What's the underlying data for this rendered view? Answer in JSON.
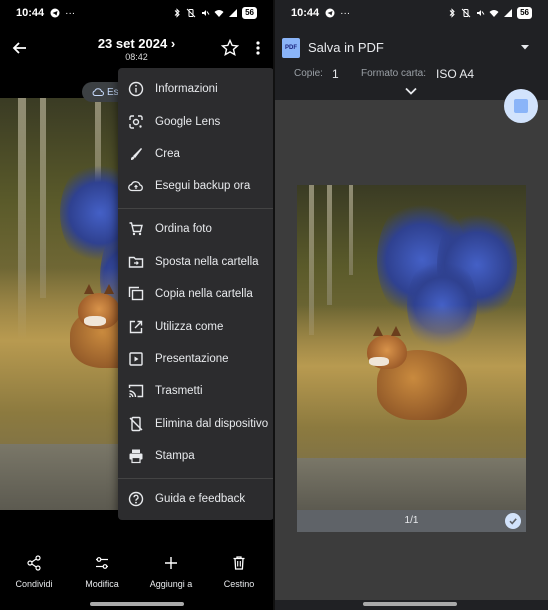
{
  "status": {
    "time": "10:44",
    "dots": "···",
    "battery": "56"
  },
  "left": {
    "header": {
      "date": "23 set 2024 ›",
      "time": "08:42"
    },
    "backup_chip": "Es",
    "menu": {
      "items": [
        {
          "label": "Informazioni",
          "icon": "info-icon"
        },
        {
          "label": "Google Lens",
          "icon": "google-lens-icon"
        },
        {
          "label": "Crea",
          "icon": "brush-icon"
        },
        {
          "label": "Esegui backup ora",
          "icon": "cloud-upload-icon"
        },
        {
          "label": "Ordina foto",
          "icon": "cart-icon"
        },
        {
          "label": "Sposta nella cartella",
          "icon": "folder-move-icon"
        },
        {
          "label": "Copia nella cartella",
          "icon": "copy-icon"
        },
        {
          "label": "Utilizza come",
          "icon": "open-in-icon"
        },
        {
          "label": "Presentazione",
          "icon": "slideshow-icon"
        },
        {
          "label": "Trasmetti",
          "icon": "cast-icon"
        },
        {
          "label": "Elimina dal dispositivo",
          "icon": "delete-device-icon"
        },
        {
          "label": "Stampa",
          "icon": "print-icon"
        },
        {
          "label": "Guida e feedback",
          "icon": "help-icon"
        }
      ]
    },
    "bottom_bar": [
      {
        "label": "Condividi",
        "icon": "share-icon"
      },
      {
        "label": "Modifica",
        "icon": "tune-icon"
      },
      {
        "label": "Aggiungi a",
        "icon": "plus-icon"
      },
      {
        "label": "Cestino",
        "icon": "trash-icon"
      }
    ]
  },
  "right": {
    "destination": "Salva in PDF",
    "copies_label": "Copie:",
    "copies_value": "1",
    "paper_label": "Formato carta:",
    "paper_value": "ISO A4",
    "page_indicator": "1/1"
  },
  "colors": {
    "menu_bg": "#2c2c2e",
    "accent": "#8ab4f8",
    "panel_bg": "#202124"
  }
}
